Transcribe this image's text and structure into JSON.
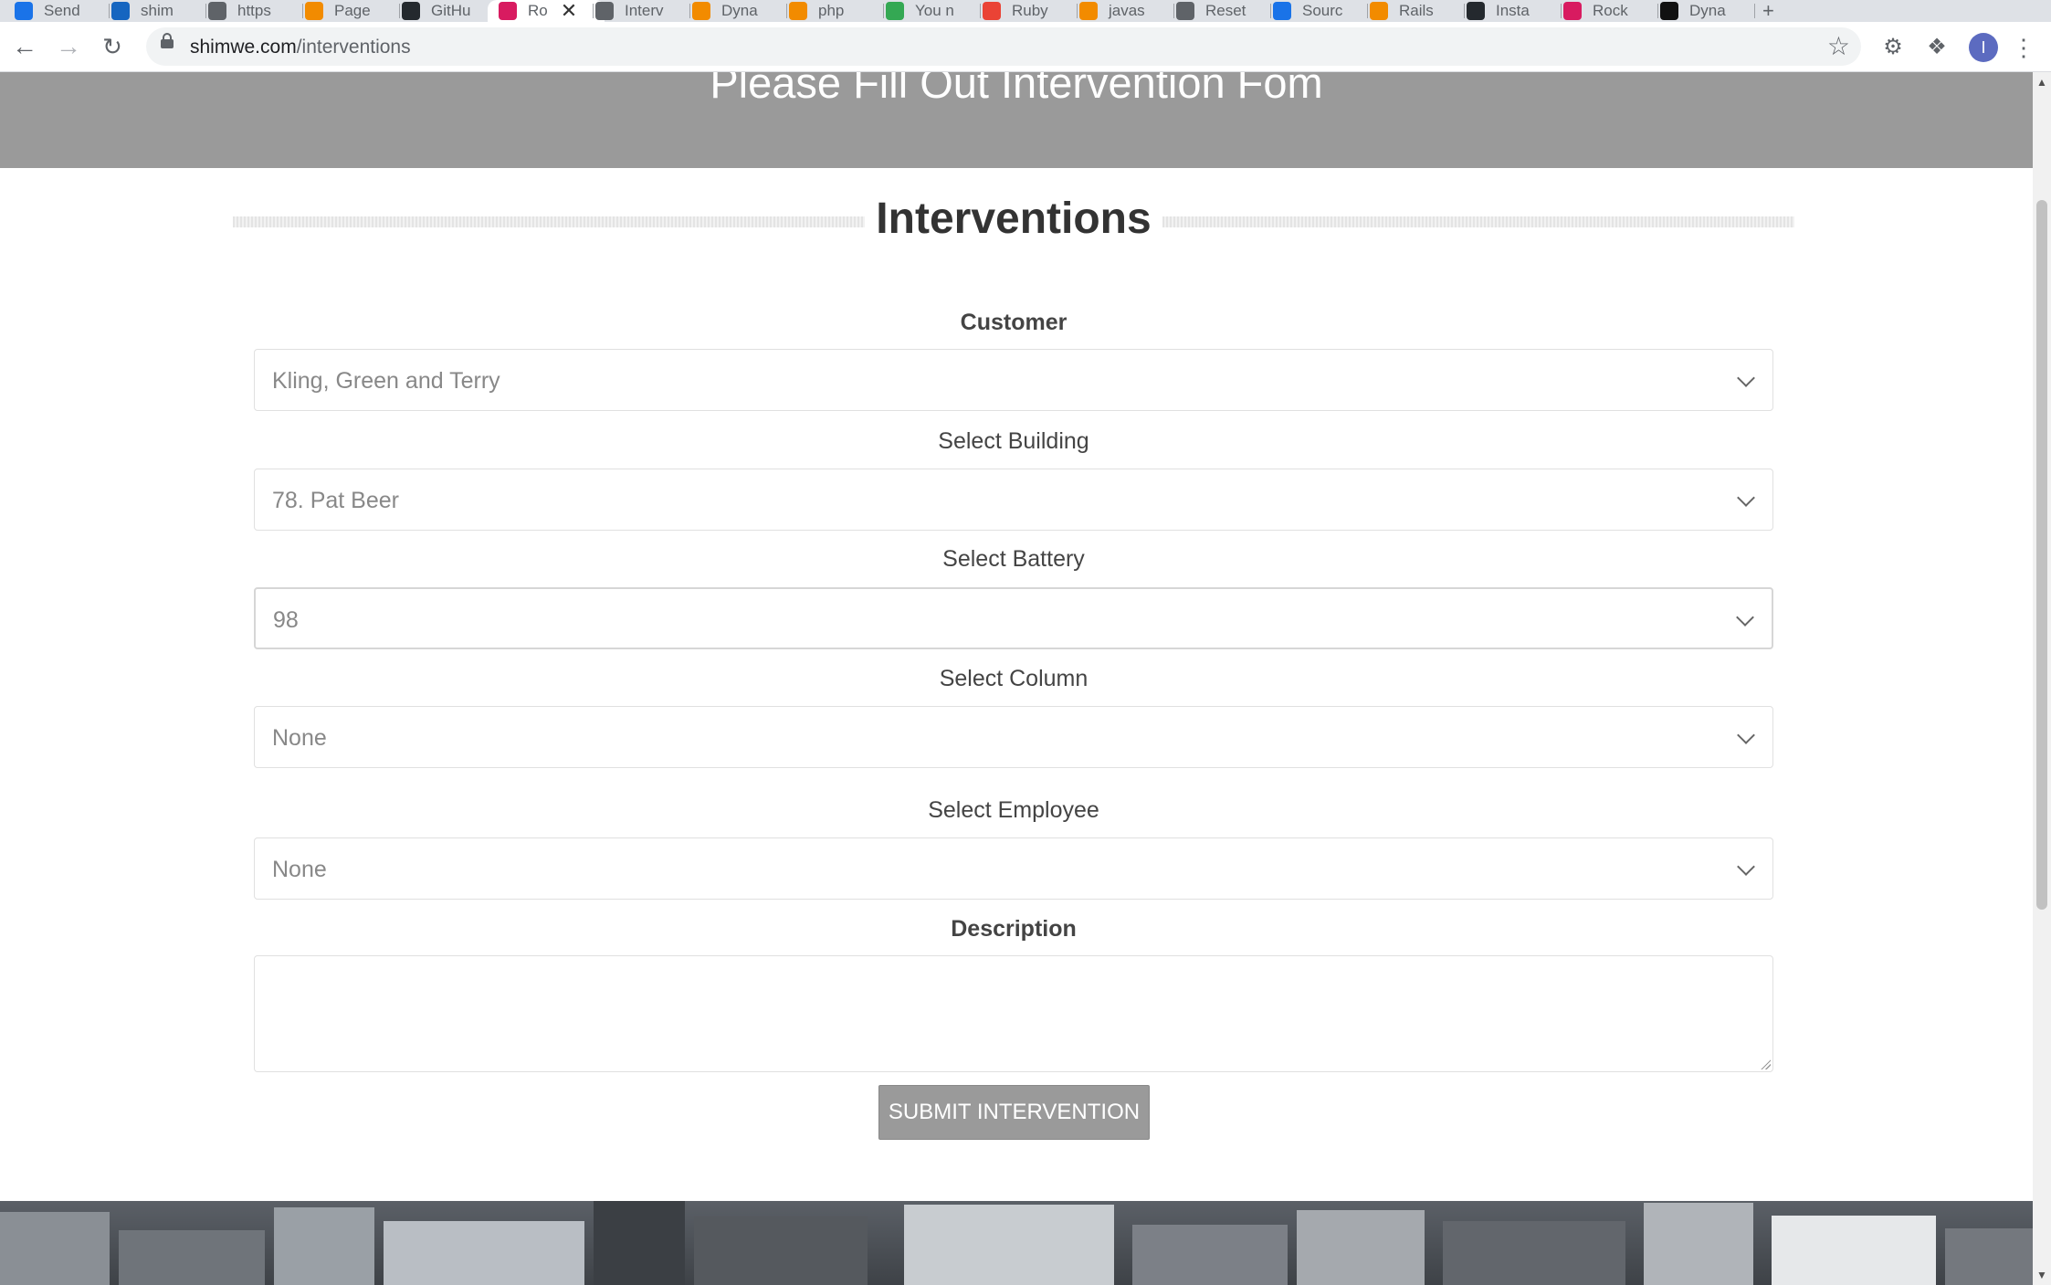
{
  "browser": {
    "tabs": [
      {
        "label": "Send",
        "color": "#1a73e8"
      },
      {
        "label": "shim",
        "color": "#1565c0"
      },
      {
        "label": "https",
        "color": "#5f6368"
      },
      {
        "label": "Page",
        "color": "#f28b00"
      },
      {
        "label": "GitHu",
        "color": "#24292e"
      },
      {
        "label": "Ro",
        "color": "#d81b60",
        "active": true
      },
      {
        "label": "Interv",
        "color": "#5f6368"
      },
      {
        "label": "Dyna",
        "color": "#f28b00"
      },
      {
        "label": "php",
        "color": "#f28b00"
      },
      {
        "label": "You n",
        "color": "#34a853"
      },
      {
        "label": "Ruby",
        "color": "#ea4335"
      },
      {
        "label": "javas",
        "color": "#f28b00"
      },
      {
        "label": "Reset",
        "color": "#5f6368"
      },
      {
        "label": "Sourc",
        "color": "#1a73e8"
      },
      {
        "label": "Rails",
        "color": "#f28b00"
      },
      {
        "label": "Insta",
        "color": "#24292e"
      },
      {
        "label": "Rock",
        "color": "#d81b60"
      },
      {
        "label": "Dyna",
        "color": "#111111"
      }
    ],
    "new_tab": "+",
    "tab_close": "✕",
    "url_domain": "shimwe.com",
    "url_path": "/interventions",
    "avatar_letter": "I"
  },
  "page": {
    "hero_title": "Please Fill Out Intervention Fom",
    "section_heading": "Interventions",
    "customer": {
      "label": "Customer",
      "value": "Kling, Green and Terry"
    },
    "building": {
      "label": "Select Building",
      "value": "78. Pat Beer"
    },
    "battery": {
      "label": "Select Battery",
      "value": "98"
    },
    "column": {
      "label": "Select Column",
      "value": "None"
    },
    "employee": {
      "label": "Select Employee",
      "value": "None"
    },
    "description": {
      "label": "Description",
      "value": ""
    },
    "submit_label": "SUBMIT INTERVENTION"
  }
}
